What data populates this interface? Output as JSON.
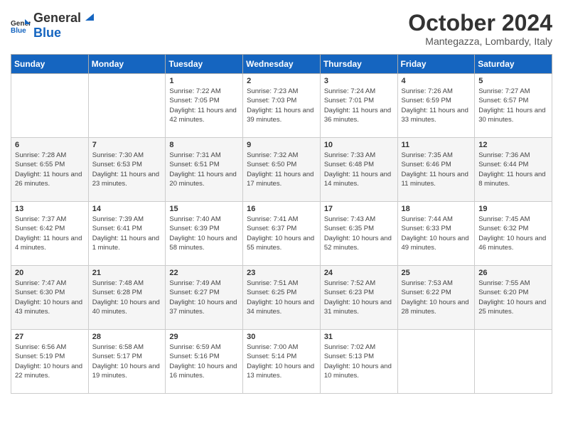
{
  "header": {
    "logo_general": "General",
    "logo_blue": "Blue",
    "month_title": "October 2024",
    "location": "Mantegazza, Lombardy, Italy"
  },
  "weekdays": [
    "Sunday",
    "Monday",
    "Tuesday",
    "Wednesday",
    "Thursday",
    "Friday",
    "Saturday"
  ],
  "weeks": [
    [
      {
        "day": "",
        "info": ""
      },
      {
        "day": "",
        "info": ""
      },
      {
        "day": "1",
        "info": "Sunrise: 7:22 AM\nSunset: 7:05 PM\nDaylight: 11 hours and 42 minutes."
      },
      {
        "day": "2",
        "info": "Sunrise: 7:23 AM\nSunset: 7:03 PM\nDaylight: 11 hours and 39 minutes."
      },
      {
        "day": "3",
        "info": "Sunrise: 7:24 AM\nSunset: 7:01 PM\nDaylight: 11 hours and 36 minutes."
      },
      {
        "day": "4",
        "info": "Sunrise: 7:26 AM\nSunset: 6:59 PM\nDaylight: 11 hours and 33 minutes."
      },
      {
        "day": "5",
        "info": "Sunrise: 7:27 AM\nSunset: 6:57 PM\nDaylight: 11 hours and 30 minutes."
      }
    ],
    [
      {
        "day": "6",
        "info": "Sunrise: 7:28 AM\nSunset: 6:55 PM\nDaylight: 11 hours and 26 minutes."
      },
      {
        "day": "7",
        "info": "Sunrise: 7:30 AM\nSunset: 6:53 PM\nDaylight: 11 hours and 23 minutes."
      },
      {
        "day": "8",
        "info": "Sunrise: 7:31 AM\nSunset: 6:51 PM\nDaylight: 11 hours and 20 minutes."
      },
      {
        "day": "9",
        "info": "Sunrise: 7:32 AM\nSunset: 6:50 PM\nDaylight: 11 hours and 17 minutes."
      },
      {
        "day": "10",
        "info": "Sunrise: 7:33 AM\nSunset: 6:48 PM\nDaylight: 11 hours and 14 minutes."
      },
      {
        "day": "11",
        "info": "Sunrise: 7:35 AM\nSunset: 6:46 PM\nDaylight: 11 hours and 11 minutes."
      },
      {
        "day": "12",
        "info": "Sunrise: 7:36 AM\nSunset: 6:44 PM\nDaylight: 11 hours and 8 minutes."
      }
    ],
    [
      {
        "day": "13",
        "info": "Sunrise: 7:37 AM\nSunset: 6:42 PM\nDaylight: 11 hours and 4 minutes."
      },
      {
        "day": "14",
        "info": "Sunrise: 7:39 AM\nSunset: 6:41 PM\nDaylight: 11 hours and 1 minute."
      },
      {
        "day": "15",
        "info": "Sunrise: 7:40 AM\nSunset: 6:39 PM\nDaylight: 10 hours and 58 minutes."
      },
      {
        "day": "16",
        "info": "Sunrise: 7:41 AM\nSunset: 6:37 PM\nDaylight: 10 hours and 55 minutes."
      },
      {
        "day": "17",
        "info": "Sunrise: 7:43 AM\nSunset: 6:35 PM\nDaylight: 10 hours and 52 minutes."
      },
      {
        "day": "18",
        "info": "Sunrise: 7:44 AM\nSunset: 6:33 PM\nDaylight: 10 hours and 49 minutes."
      },
      {
        "day": "19",
        "info": "Sunrise: 7:45 AM\nSunset: 6:32 PM\nDaylight: 10 hours and 46 minutes."
      }
    ],
    [
      {
        "day": "20",
        "info": "Sunrise: 7:47 AM\nSunset: 6:30 PM\nDaylight: 10 hours and 43 minutes."
      },
      {
        "day": "21",
        "info": "Sunrise: 7:48 AM\nSunset: 6:28 PM\nDaylight: 10 hours and 40 minutes."
      },
      {
        "day": "22",
        "info": "Sunrise: 7:49 AM\nSunset: 6:27 PM\nDaylight: 10 hours and 37 minutes."
      },
      {
        "day": "23",
        "info": "Sunrise: 7:51 AM\nSunset: 6:25 PM\nDaylight: 10 hours and 34 minutes."
      },
      {
        "day": "24",
        "info": "Sunrise: 7:52 AM\nSunset: 6:23 PM\nDaylight: 10 hours and 31 minutes."
      },
      {
        "day": "25",
        "info": "Sunrise: 7:53 AM\nSunset: 6:22 PM\nDaylight: 10 hours and 28 minutes."
      },
      {
        "day": "26",
        "info": "Sunrise: 7:55 AM\nSunset: 6:20 PM\nDaylight: 10 hours and 25 minutes."
      }
    ],
    [
      {
        "day": "27",
        "info": "Sunrise: 6:56 AM\nSunset: 5:19 PM\nDaylight: 10 hours and 22 minutes."
      },
      {
        "day": "28",
        "info": "Sunrise: 6:58 AM\nSunset: 5:17 PM\nDaylight: 10 hours and 19 minutes."
      },
      {
        "day": "29",
        "info": "Sunrise: 6:59 AM\nSunset: 5:16 PM\nDaylight: 10 hours and 16 minutes."
      },
      {
        "day": "30",
        "info": "Sunrise: 7:00 AM\nSunset: 5:14 PM\nDaylight: 10 hours and 13 minutes."
      },
      {
        "day": "31",
        "info": "Sunrise: 7:02 AM\nSunset: 5:13 PM\nDaylight: 10 hours and 10 minutes."
      },
      {
        "day": "",
        "info": ""
      },
      {
        "day": "",
        "info": ""
      }
    ]
  ]
}
